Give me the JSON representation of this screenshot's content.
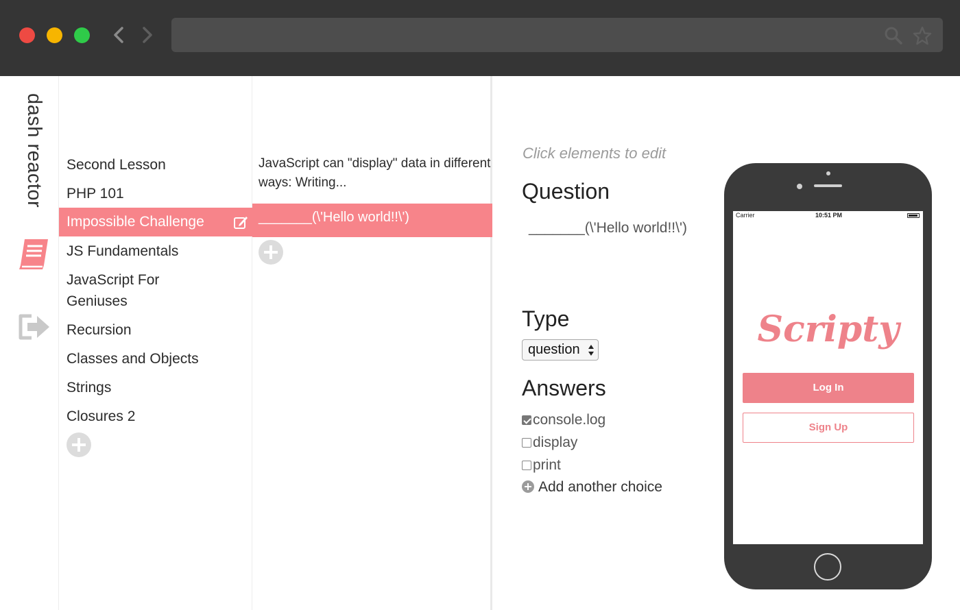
{
  "browser": {
    "url": ""
  },
  "app": {
    "brand": "dash reactor"
  },
  "lessons": {
    "items": [
      {
        "label": "Second Lesson"
      },
      {
        "label": "PHP 101"
      },
      {
        "label": "Impossible Challenge",
        "active": true
      },
      {
        "label": "JS Fundamentals"
      },
      {
        "label": "JavaScript For Geniuses"
      },
      {
        "label": "Recursion"
      },
      {
        "label": "Classes and Objects"
      },
      {
        "label": "Strings"
      },
      {
        "label": "Closures 2"
      }
    ]
  },
  "questions": {
    "description": "JavaScript can \"display\" data in different ways: Writing...",
    "selected": "_______(\\'Hello world!!\\')"
  },
  "editor": {
    "hint": "Click elements to edit",
    "question_heading": "Question",
    "question_text": "_______(\\'Hello world!!\\')",
    "type_heading": "Type",
    "type_value": "question",
    "answers_heading": "Answers",
    "answers": [
      {
        "text": "console.log",
        "checked": true
      },
      {
        "text": "display",
        "checked": false
      },
      {
        "text": "print",
        "checked": false
      }
    ],
    "add_choice": "Add another choice"
  },
  "phone": {
    "carrier": "Carrier",
    "time": "10:51 PM",
    "login_label": "Log In",
    "signup_label": "Sign Up"
  },
  "colors": {
    "accent": "#f7848a",
    "chrome": "#353535",
    "phone_body": "#3a3a3a"
  }
}
